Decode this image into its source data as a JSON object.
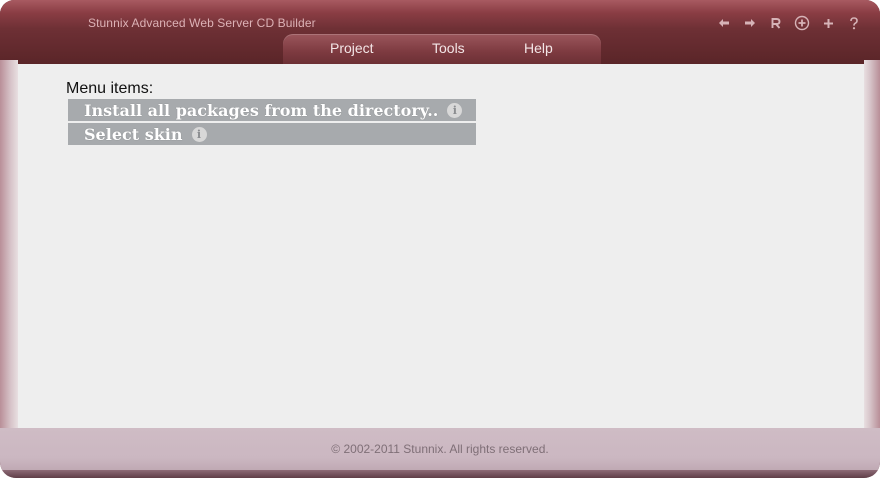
{
  "window": {
    "title": "Stunnix Advanced Web Server CD Builder",
    "controls": [
      {
        "name": "back-icon",
        "glyph": "arrow-left"
      },
      {
        "name": "forward-icon",
        "glyph": "arrow-right"
      },
      {
        "name": "reload-icon",
        "glyph": "R"
      },
      {
        "name": "zoom-icon",
        "glyph": "circle-plus"
      },
      {
        "name": "add-icon",
        "glyph": "+"
      },
      {
        "name": "help-icon",
        "glyph": "?"
      }
    ]
  },
  "menu": {
    "items": [
      {
        "label": "Project"
      },
      {
        "label": "Tools"
      },
      {
        "label": "Help"
      }
    ]
  },
  "main": {
    "section_label": "Menu items:",
    "items": [
      {
        "label": "Install all packages from the directory.."
      },
      {
        "label": "Select skin"
      }
    ]
  },
  "footer": {
    "copyright": "© 2002-2011 Stunnix. All rights reserved."
  },
  "colors": {
    "frame": "#6e3035",
    "content_bg": "#eeeeee",
    "item_bg": "#a7aaad",
    "footer_bg": "#cbb7c1"
  }
}
